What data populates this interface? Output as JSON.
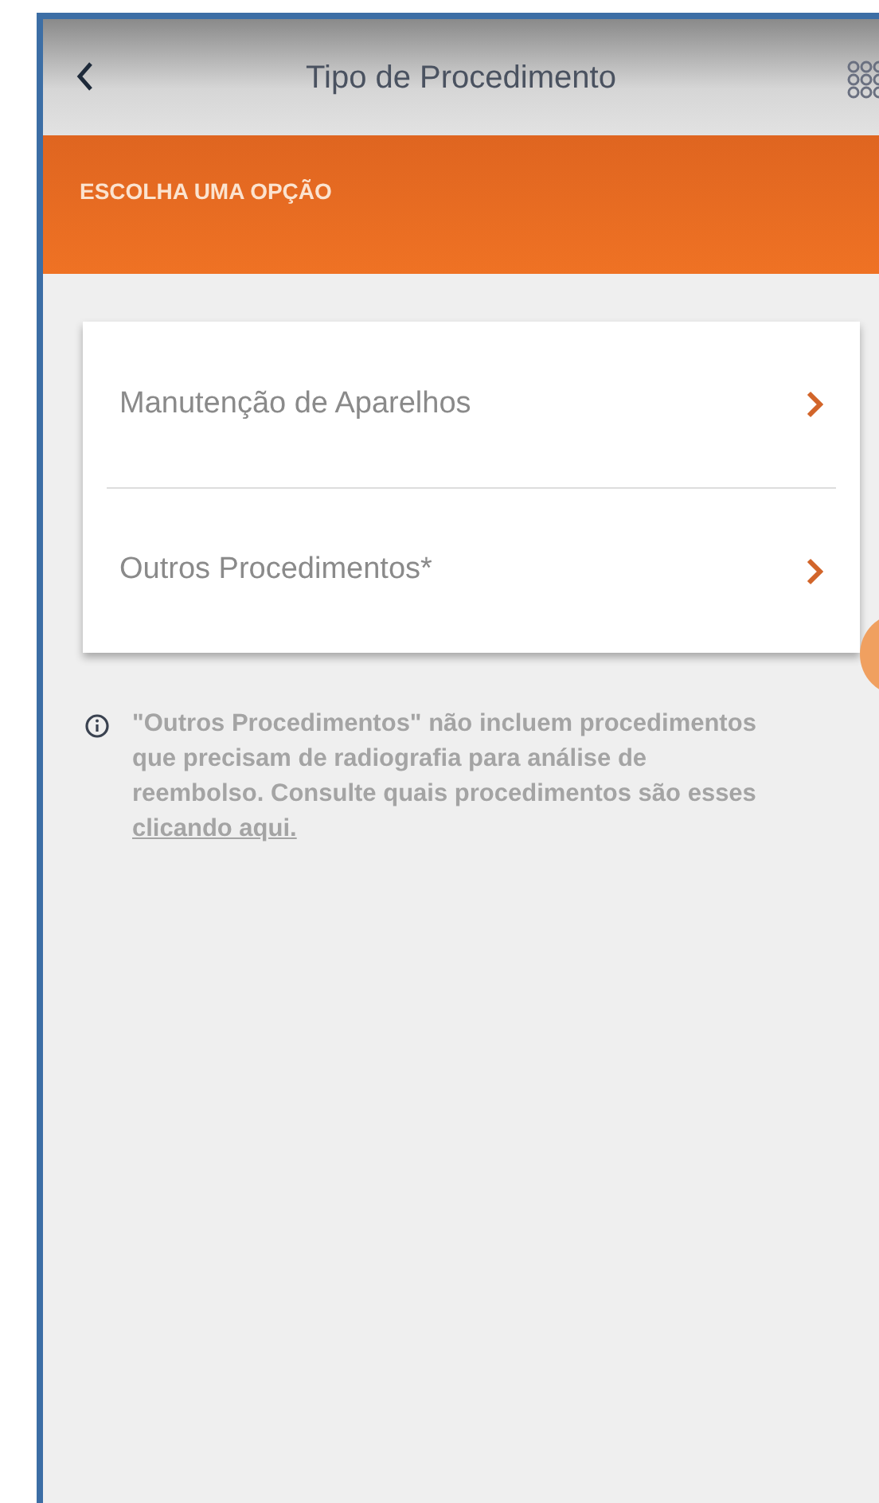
{
  "header": {
    "title": "Tipo de Procedimento"
  },
  "banner": {
    "label": "ESCOLHA UMA OPÇÃO"
  },
  "options": [
    {
      "label": "Manutenção de Aparelhos"
    },
    {
      "label": "Outros Procedimentos*"
    }
  ],
  "note": {
    "text": "\"Outros Procedimentos\" não incluem procedimentos que precisam de radiografia para análise de reembolso. Consulte quais procedimentos são esses",
    "link": "clicando aqui."
  }
}
